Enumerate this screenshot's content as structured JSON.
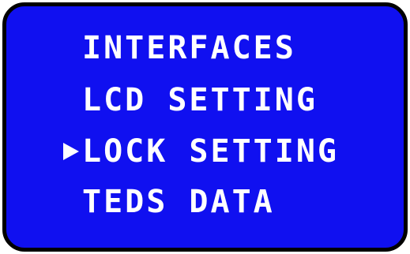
{
  "display": {
    "background_color": "#1010f0",
    "text_color": "#ffffff",
    "frame_color": "#000000"
  },
  "menu": {
    "items": [
      {
        "label": "INTERFACES",
        "selected": false
      },
      {
        "label": "LCD SETTING",
        "selected": false
      },
      {
        "label": "LOCK SETTING",
        "selected": true
      },
      {
        "label": "TEDS DATA",
        "selected": false
      }
    ],
    "cursor_icon": "right-triangle-pointer-icon"
  }
}
